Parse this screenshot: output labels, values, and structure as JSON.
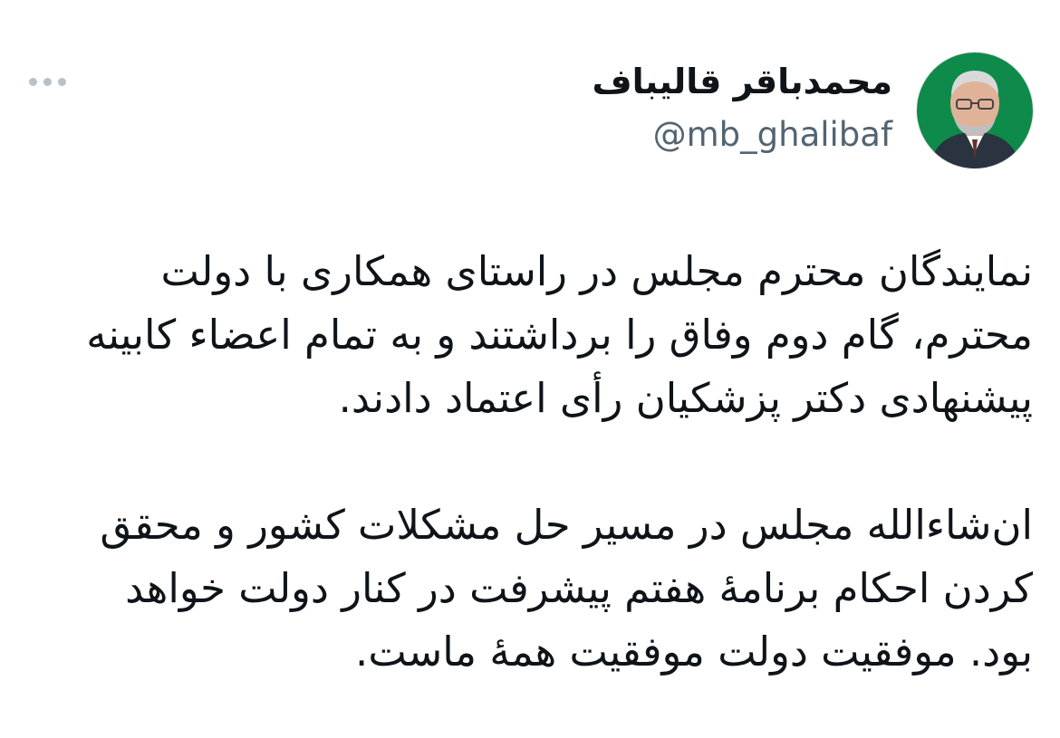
{
  "tweet": {
    "author": {
      "display_name": "محمدباقر قالیباف",
      "handle": "@mb_ghalibaf"
    },
    "more_icon": "more-horizontal-icon",
    "paragraphs": [
      "نمایندگان محترم مجلس در راستای همکاری با دولت محترم، گام دوم وفاق را برداشتند و به تمام اعضاء کابینه پیشنهادی دکتر پزشکیان رأی اعتماد دادند.",
      "ان‌شاءالله مجلس در مسیر حل مشکلات کشور و محقق کردن احکام برنامهٔ هفتم پیشرفت در کنار دولت خواهد بود. موفقیت دولت موفقیت همهٔ ماست."
    ]
  },
  "colors": {
    "text": "#0f1419",
    "secondary": "#536471",
    "avatar_bg": "#0e8a4a"
  }
}
